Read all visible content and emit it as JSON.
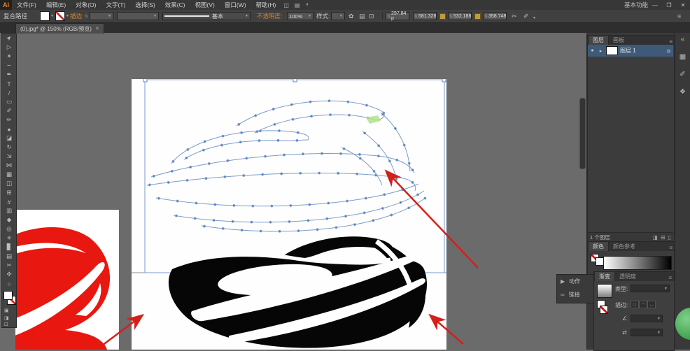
{
  "app": {
    "logo": "Ai",
    "workspace_label": "基本功能",
    "window_controls": {
      "minimize": "—",
      "restore": "❐",
      "close": "✕"
    }
  },
  "menubar": {
    "items": [
      {
        "label": "文件(F)"
      },
      {
        "label": "编辑(E)"
      },
      {
        "label": "对象(O)"
      },
      {
        "label": "文字(T)"
      },
      {
        "label": "选择(S)"
      },
      {
        "label": "效果(C)"
      },
      {
        "label": "视图(V)"
      },
      {
        "label": "窗口(W)"
      },
      {
        "label": "帮助(H)"
      }
    ]
  },
  "icons": {
    "caret": "▼",
    "caret_small": "⌄",
    "stepper": "⇅",
    "separator": "|",
    "menu": "≡",
    "collapse": "«",
    "bridge": "◫",
    "arrange": "▤",
    "eye": "●",
    "expand": "▸",
    "target": "◎",
    "play": "▶",
    "link": "∞",
    "scissors": "✂",
    "pen_small": "✐",
    "recolor": "✿",
    "align": "▤",
    "artboard_small": "⊡",
    "panel_swatches": "▦",
    "panel_brushes": "✐",
    "panel_symbols": "❖",
    "new_layer": "⊞",
    "clip_layer": "◨",
    "delete_layer": "▯",
    "angle": "∠",
    "reverse": "⇄"
  },
  "controlbar": {
    "selection_label": "复合路径",
    "stroke_label": "描边:",
    "brush_value": "基本",
    "opacity_label": "不透明度:",
    "opacity_value": "100%",
    "style_label": "样式:",
    "transform": {
      "x": "297.84 p",
      "y": "581.328",
      "w": "532.188",
      "h": "358.748"
    }
  },
  "document_tab": {
    "title": "(0).jpg* @ 150% (RGB/预览)",
    "close_glyph": "✕"
  },
  "tools": [
    {
      "name": "selection-tool",
      "glyph": "➤"
    },
    {
      "name": "direct-selection-tool",
      "glyph": "▷"
    },
    {
      "name": "magic-wand-tool",
      "glyph": "✶"
    },
    {
      "name": "lasso-tool",
      "glyph": "∽"
    },
    {
      "name": "pen-tool",
      "glyph": "✒"
    },
    {
      "name": "type-tool",
      "glyph": "T"
    },
    {
      "name": "line-segment-tool",
      "glyph": "/"
    },
    {
      "name": "rectangle-tool",
      "glyph": "▭"
    },
    {
      "name": "paintbrush-tool",
      "glyph": "✐"
    },
    {
      "name": "pencil-tool",
      "glyph": "✏"
    },
    {
      "name": "blob-brush-tool",
      "glyph": "●"
    },
    {
      "name": "eraser-tool",
      "glyph": "◪"
    },
    {
      "name": "rotate-tool",
      "glyph": "↻"
    },
    {
      "name": "scale-tool",
      "glyph": "⇲"
    },
    {
      "name": "width-tool",
      "glyph": "⋈"
    },
    {
      "name": "free-transform-tool",
      "glyph": "▦"
    },
    {
      "name": "shape-builder-tool",
      "glyph": "◫"
    },
    {
      "name": "perspective-grid-tool",
      "glyph": "⊞"
    },
    {
      "name": "mesh-tool",
      "glyph": "#"
    },
    {
      "name": "gradient-tool",
      "glyph": "▥"
    },
    {
      "name": "eyedropper-tool",
      "glyph": "◆"
    },
    {
      "name": "blend-tool",
      "glyph": "◎"
    },
    {
      "name": "symbol-sprayer-tool",
      "glyph": "✳"
    },
    {
      "name": "column-graph-tool",
      "glyph": "▊"
    },
    {
      "name": "artboard-tool",
      "glyph": "▤"
    },
    {
      "name": "slice-tool",
      "glyph": "✂"
    },
    {
      "name": "hand-tool",
      "glyph": "✣"
    },
    {
      "name": "zoom-tool",
      "glyph": "○"
    }
  ],
  "layers_panel": {
    "tab_layers": "图层",
    "tab_artboards": "画板",
    "layer_name": "图层 1",
    "status": "1 个图层"
  },
  "color_panel": {
    "tab_color": "颜色",
    "tab_guide": "颜色参考"
  },
  "actions_panel": {
    "item1": "动作",
    "item2": "链接"
  },
  "gradient_panel": {
    "tab_gradient": "渐变",
    "tab_transparency": "透明度",
    "type_label": "类型:",
    "stroke_label": "描边:"
  },
  "colors": {
    "canvas": "#6b6b6b",
    "chrome": "#3d3d3d",
    "artwork_black": "#060606",
    "artwork_red": "#e8170f",
    "wireframe_blue": "#7d9cc8",
    "anchor_blue": "#4a72b8",
    "selection_blue": "#7b9bd4",
    "annotation_arrow": "#d42019",
    "green_badge": "#4fae5c"
  }
}
